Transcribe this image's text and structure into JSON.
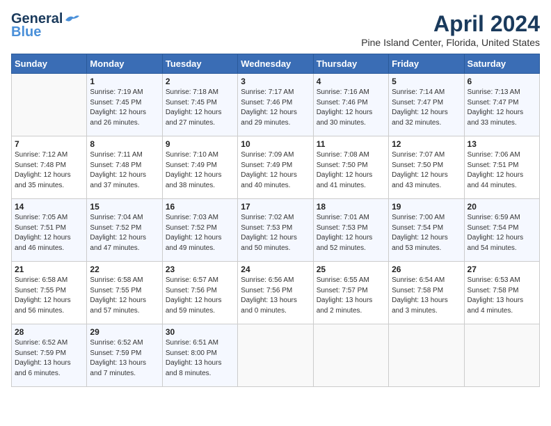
{
  "header": {
    "logo_line1": "General",
    "logo_line2": "Blue",
    "month_year": "April 2024",
    "location": "Pine Island Center, Florida, United States"
  },
  "days_of_week": [
    "Sunday",
    "Monday",
    "Tuesday",
    "Wednesday",
    "Thursday",
    "Friday",
    "Saturday"
  ],
  "weeks": [
    [
      {
        "num": "",
        "info": ""
      },
      {
        "num": "1",
        "info": "Sunrise: 7:19 AM\nSunset: 7:45 PM\nDaylight: 12 hours\nand 26 minutes."
      },
      {
        "num": "2",
        "info": "Sunrise: 7:18 AM\nSunset: 7:45 PM\nDaylight: 12 hours\nand 27 minutes."
      },
      {
        "num": "3",
        "info": "Sunrise: 7:17 AM\nSunset: 7:46 PM\nDaylight: 12 hours\nand 29 minutes."
      },
      {
        "num": "4",
        "info": "Sunrise: 7:16 AM\nSunset: 7:46 PM\nDaylight: 12 hours\nand 30 minutes."
      },
      {
        "num": "5",
        "info": "Sunrise: 7:14 AM\nSunset: 7:47 PM\nDaylight: 12 hours\nand 32 minutes."
      },
      {
        "num": "6",
        "info": "Sunrise: 7:13 AM\nSunset: 7:47 PM\nDaylight: 12 hours\nand 33 minutes."
      }
    ],
    [
      {
        "num": "7",
        "info": "Sunrise: 7:12 AM\nSunset: 7:48 PM\nDaylight: 12 hours\nand 35 minutes."
      },
      {
        "num": "8",
        "info": "Sunrise: 7:11 AM\nSunset: 7:48 PM\nDaylight: 12 hours\nand 37 minutes."
      },
      {
        "num": "9",
        "info": "Sunrise: 7:10 AM\nSunset: 7:49 PM\nDaylight: 12 hours\nand 38 minutes."
      },
      {
        "num": "10",
        "info": "Sunrise: 7:09 AM\nSunset: 7:49 PM\nDaylight: 12 hours\nand 40 minutes."
      },
      {
        "num": "11",
        "info": "Sunrise: 7:08 AM\nSunset: 7:50 PM\nDaylight: 12 hours\nand 41 minutes."
      },
      {
        "num": "12",
        "info": "Sunrise: 7:07 AM\nSunset: 7:50 PM\nDaylight: 12 hours\nand 43 minutes."
      },
      {
        "num": "13",
        "info": "Sunrise: 7:06 AM\nSunset: 7:51 PM\nDaylight: 12 hours\nand 44 minutes."
      }
    ],
    [
      {
        "num": "14",
        "info": "Sunrise: 7:05 AM\nSunset: 7:51 PM\nDaylight: 12 hours\nand 46 minutes."
      },
      {
        "num": "15",
        "info": "Sunrise: 7:04 AM\nSunset: 7:52 PM\nDaylight: 12 hours\nand 47 minutes."
      },
      {
        "num": "16",
        "info": "Sunrise: 7:03 AM\nSunset: 7:52 PM\nDaylight: 12 hours\nand 49 minutes."
      },
      {
        "num": "17",
        "info": "Sunrise: 7:02 AM\nSunset: 7:53 PM\nDaylight: 12 hours\nand 50 minutes."
      },
      {
        "num": "18",
        "info": "Sunrise: 7:01 AM\nSunset: 7:53 PM\nDaylight: 12 hours\nand 52 minutes."
      },
      {
        "num": "19",
        "info": "Sunrise: 7:00 AM\nSunset: 7:54 PM\nDaylight: 12 hours\nand 53 minutes."
      },
      {
        "num": "20",
        "info": "Sunrise: 6:59 AM\nSunset: 7:54 PM\nDaylight: 12 hours\nand 54 minutes."
      }
    ],
    [
      {
        "num": "21",
        "info": "Sunrise: 6:58 AM\nSunset: 7:55 PM\nDaylight: 12 hours\nand 56 minutes."
      },
      {
        "num": "22",
        "info": "Sunrise: 6:58 AM\nSunset: 7:55 PM\nDaylight: 12 hours\nand 57 minutes."
      },
      {
        "num": "23",
        "info": "Sunrise: 6:57 AM\nSunset: 7:56 PM\nDaylight: 12 hours\nand 59 minutes."
      },
      {
        "num": "24",
        "info": "Sunrise: 6:56 AM\nSunset: 7:56 PM\nDaylight: 13 hours\nand 0 minutes."
      },
      {
        "num": "25",
        "info": "Sunrise: 6:55 AM\nSunset: 7:57 PM\nDaylight: 13 hours\nand 2 minutes."
      },
      {
        "num": "26",
        "info": "Sunrise: 6:54 AM\nSunset: 7:58 PM\nDaylight: 13 hours\nand 3 minutes."
      },
      {
        "num": "27",
        "info": "Sunrise: 6:53 AM\nSunset: 7:58 PM\nDaylight: 13 hours\nand 4 minutes."
      }
    ],
    [
      {
        "num": "28",
        "info": "Sunrise: 6:52 AM\nSunset: 7:59 PM\nDaylight: 13 hours\nand 6 minutes."
      },
      {
        "num": "29",
        "info": "Sunrise: 6:52 AM\nSunset: 7:59 PM\nDaylight: 13 hours\nand 7 minutes."
      },
      {
        "num": "30",
        "info": "Sunrise: 6:51 AM\nSunset: 8:00 PM\nDaylight: 13 hours\nand 8 minutes."
      },
      {
        "num": "",
        "info": ""
      },
      {
        "num": "",
        "info": ""
      },
      {
        "num": "",
        "info": ""
      },
      {
        "num": "",
        "info": ""
      }
    ]
  ]
}
